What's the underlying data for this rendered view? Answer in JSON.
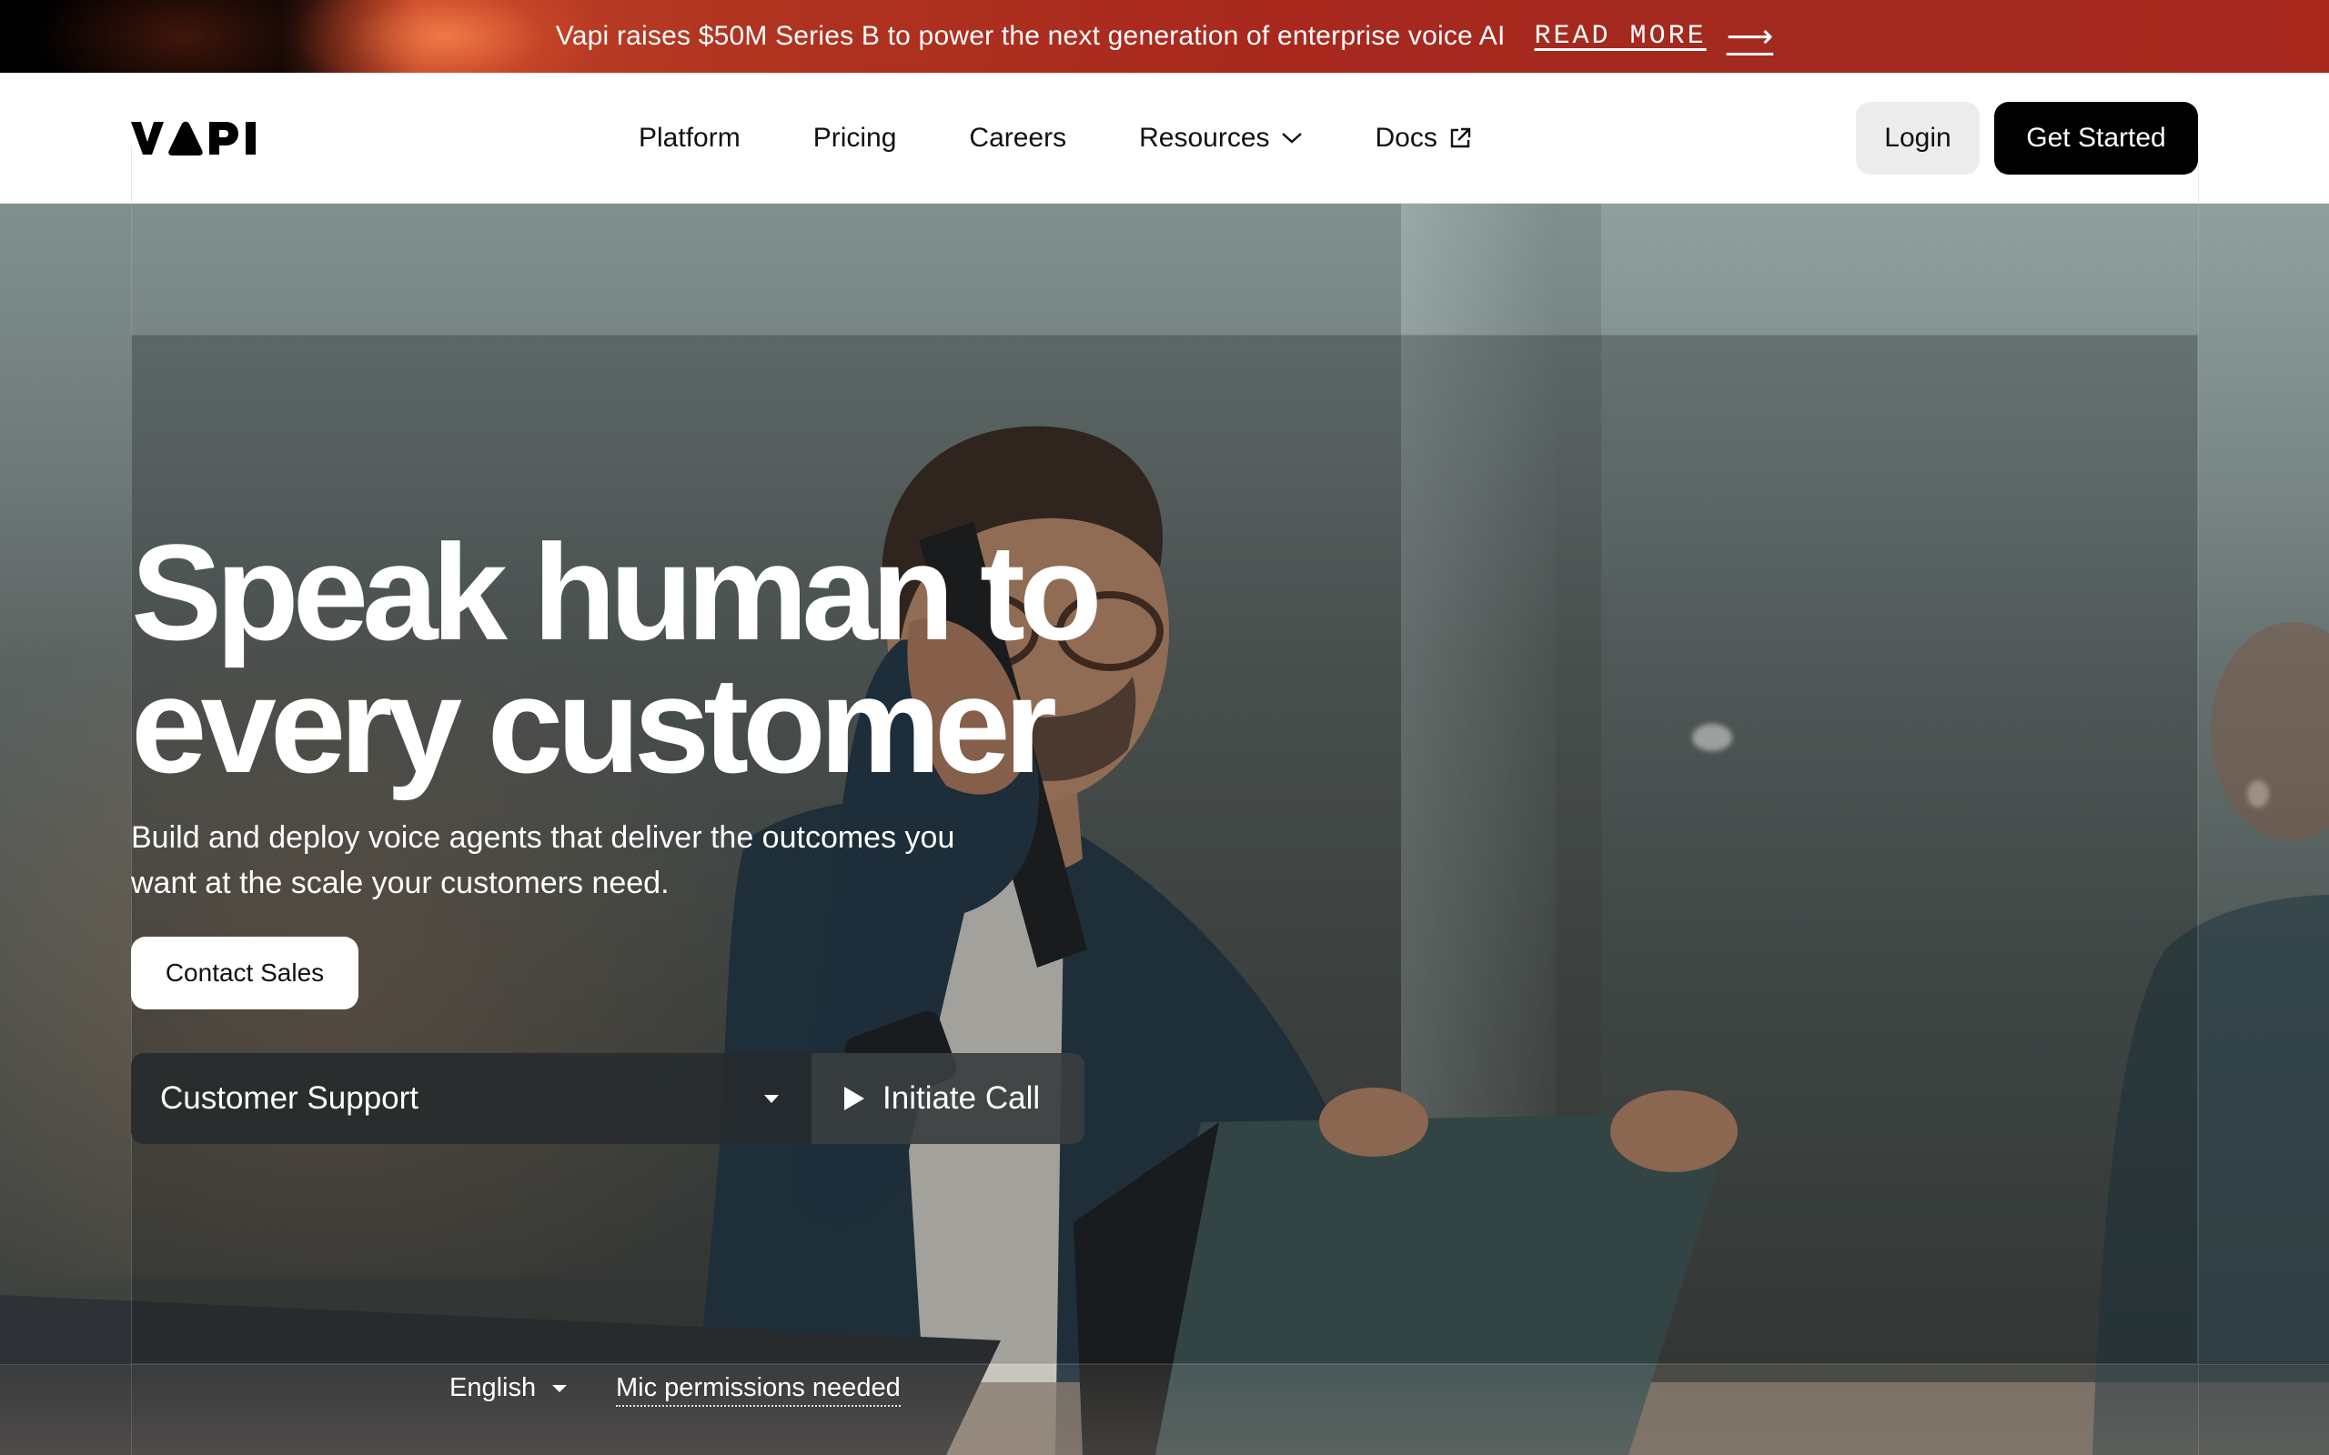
{
  "banner": {
    "text": "Vapi raises $50M Series B to power the next generation of enterprise voice AI",
    "link_label": "READ MORE",
    "arrow_icon": "arrow-right-icon"
  },
  "nav": {
    "logo_text": "VAPI",
    "links": [
      {
        "label": "Platform"
      },
      {
        "label": "Pricing"
      },
      {
        "label": "Careers"
      },
      {
        "label": "Resources",
        "icon": "chevron-down-icon"
      },
      {
        "label": "Docs",
        "icon": "external-link-icon"
      }
    ],
    "login_label": "Login",
    "get_started_label": "Get Started"
  },
  "hero": {
    "headline_line1": "Speak human to",
    "headline_line2": "every customer",
    "subtext_line1": "Build and deploy voice agents that deliver the outcomes you",
    "subtext_line2": "want at the scale your customers need.",
    "contact_label": "Contact Sales",
    "agent_select_value": "Customer Support",
    "initiate_label": "Initiate Call",
    "language_value": "English",
    "mic_status": "Mic permissions needed"
  },
  "colors": {
    "banner_red": "#a8281e",
    "primary_button": "#000000",
    "secondary_button": "#ececec"
  }
}
